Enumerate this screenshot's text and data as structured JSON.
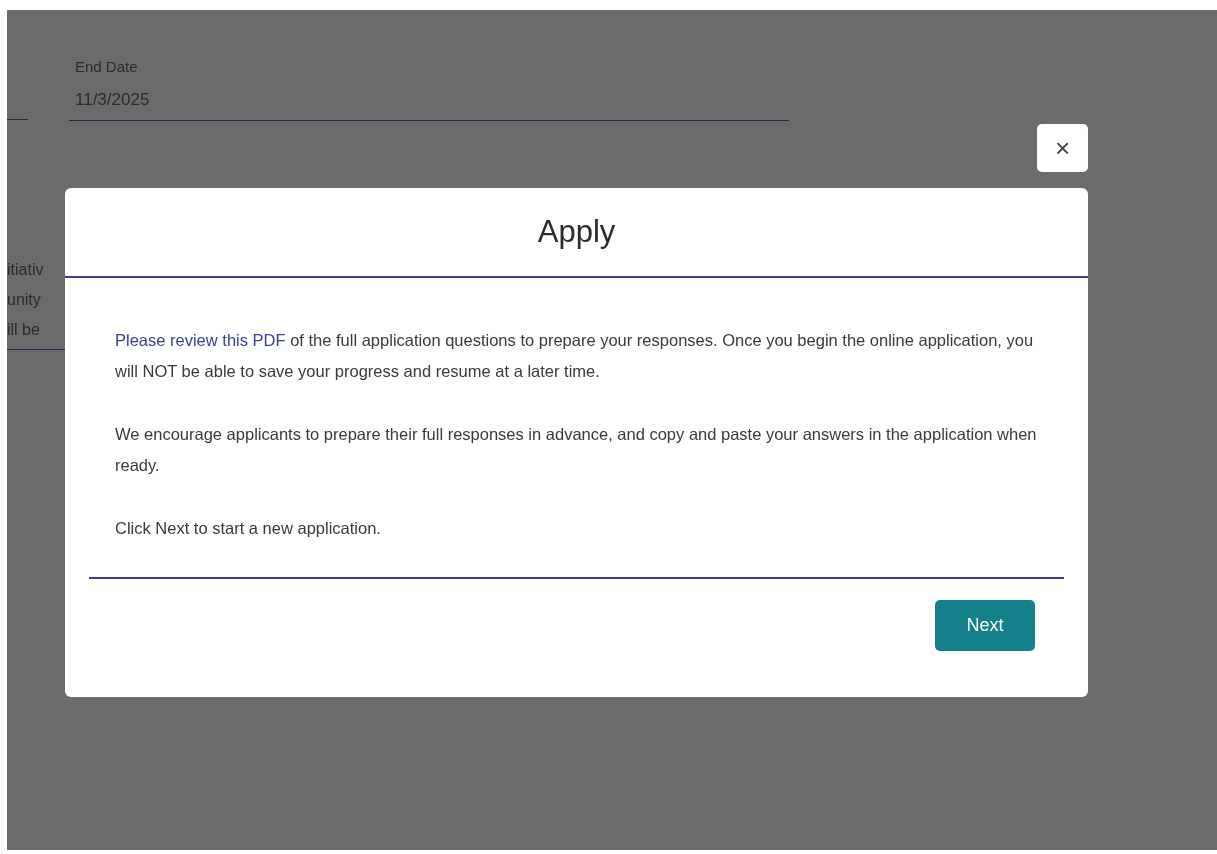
{
  "background_form": {
    "end_date": {
      "label": "End Date",
      "value": "11/3/2025"
    },
    "cut_lines": [
      "itiativ",
      "unity",
      "ill be"
    ]
  },
  "dialog": {
    "title": "Apply",
    "paragraphs": [
      {
        "link": "Please review this PDF",
        "text": " of the full application questions to prepare your responses. Once you begin the online application, you will NOT be able to save your progress and resume at a later time."
      },
      {
        "text": "We encourage applicants to prepare their full responses in advance, and copy and paste your answers in the application when ready."
      },
      {
        "text": "Click Next to start a new application."
      }
    ],
    "close": "×",
    "button": "Next"
  }
}
